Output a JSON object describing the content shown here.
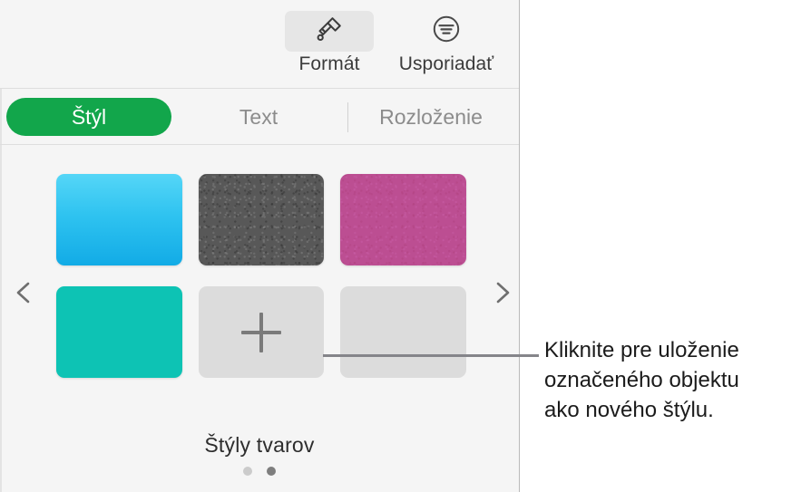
{
  "toolbar": {
    "items": [
      {
        "label": "Formát",
        "icon": "paintbrush-icon",
        "selected": true
      },
      {
        "label": "Usporiadať",
        "icon": "arrange-align-icon",
        "selected": false
      }
    ]
  },
  "tabs": {
    "items": [
      {
        "label": "Štýl",
        "selected": true
      },
      {
        "label": "Text",
        "selected": false
      },
      {
        "label": "Rozloženie",
        "selected": false
      }
    ],
    "selected_color": "#12A64B"
  },
  "styles_panel": {
    "footer_label": "Štýly tvarov",
    "prev_icon": "chevron-left-icon",
    "next_icon": "chevron-right-icon",
    "pagination": {
      "pages": 2,
      "current": 2
    },
    "swatches": [
      {
        "name": "blue-gradient-style",
        "color": "#2FC3F0",
        "kind": "gradient"
      },
      {
        "name": "dark-gray-texture-style",
        "color": "#585858",
        "kind": "texture"
      },
      {
        "name": "magenta-style",
        "color": "#BC4E92",
        "kind": "texture"
      },
      {
        "name": "teal-style",
        "color": "#0DC3B4",
        "kind": "solid"
      },
      {
        "name": "add-style-button",
        "color": "#DCDCDC",
        "kind": "add",
        "icon": "plus-icon"
      },
      {
        "name": "empty-style-slot",
        "color": "#DCDCDC",
        "kind": "empty"
      }
    ]
  },
  "callout": {
    "lines": [
      "Kliknite pre uloženie",
      "označeného objektu",
      "ako nového štýlu."
    ],
    "line_color": "#85858A"
  }
}
